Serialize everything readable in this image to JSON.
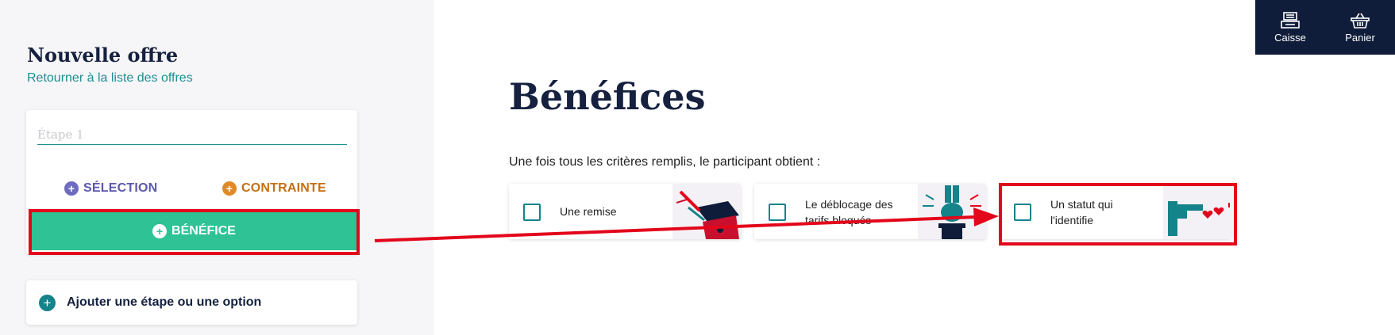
{
  "sidebar": {
    "title": "Nouvelle offre",
    "back_link": "Retourner à la liste des offres",
    "step": {
      "placeholder": "Étape 1",
      "value": ""
    },
    "chips": {
      "selection": "SÉLECTION",
      "contrainte": "CONTRAINTE",
      "benefice": "BÉNÉFICE"
    },
    "add_step": "Ajouter une étape ou une option"
  },
  "topbar": {
    "caisse": "Caisse",
    "panier": "Panier"
  },
  "main": {
    "title": "Bénéfices",
    "subtitle": "Une fois tous les critères remplis, le participant obtient :",
    "options": [
      {
        "label": "Une remise"
      },
      {
        "label": "Le déblocage des tarifs bloqués"
      },
      {
        "label": "Un statut qui l'identifie"
      }
    ]
  },
  "colors": {
    "accent_teal": "#14838a",
    "benefice_green": "#2ec294",
    "selection_purple": "#6e6bc0",
    "contrainte_orange": "#e08a27",
    "highlight_red": "#e3061b",
    "navy": "#0f1d3a"
  },
  "icons": {
    "caisse": "cash-register-icon",
    "panier": "basket-icon",
    "plus": "plus-circle-icon"
  }
}
